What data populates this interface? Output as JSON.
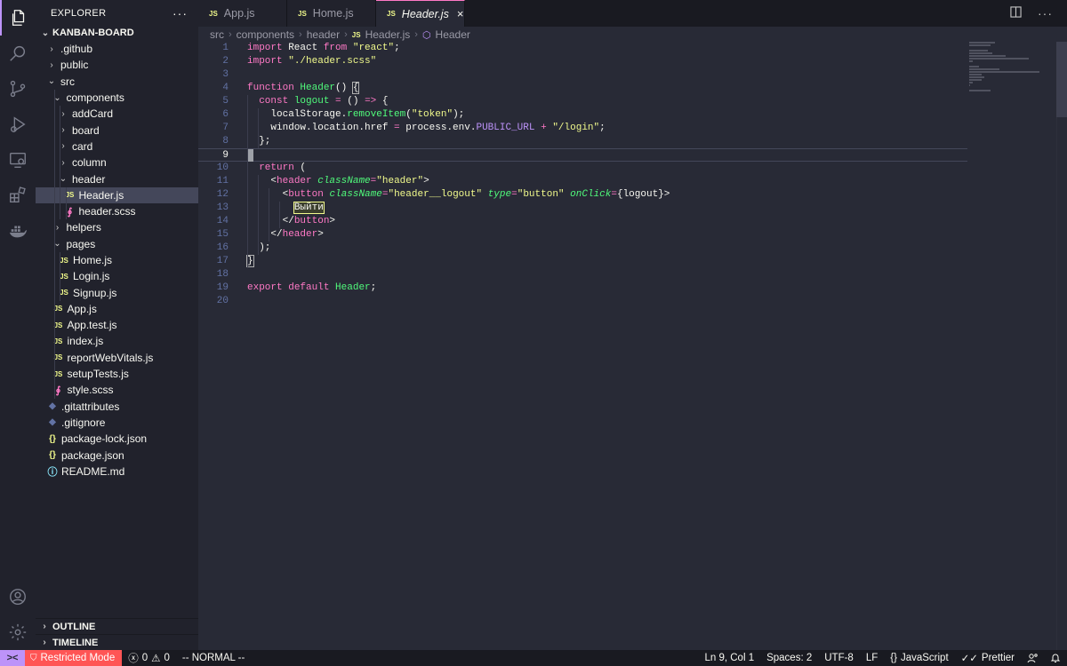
{
  "sidebar": {
    "title": "EXPLORER",
    "more_icon": "···",
    "project": "KANBAN-BOARD",
    "tree": [
      {
        "label": ".github",
        "depth": 1,
        "type": "folder",
        "open": false
      },
      {
        "label": "public",
        "depth": 1,
        "type": "folder",
        "open": false
      },
      {
        "label": "src",
        "depth": 1,
        "type": "folder",
        "open": true
      },
      {
        "label": "components",
        "depth": 2,
        "type": "folder",
        "open": true
      },
      {
        "label": "addCard",
        "depth": 3,
        "type": "folder",
        "open": false
      },
      {
        "label": "board",
        "depth": 3,
        "type": "folder",
        "open": false
      },
      {
        "label": "card",
        "depth": 3,
        "type": "folder",
        "open": false
      },
      {
        "label": "column",
        "depth": 3,
        "type": "folder",
        "open": false
      },
      {
        "label": "header",
        "depth": 3,
        "type": "folder",
        "open": true
      },
      {
        "label": "Header.js",
        "depth": 4,
        "type": "js",
        "selected": true
      },
      {
        "label": "header.scss",
        "depth": 4,
        "type": "scss"
      },
      {
        "label": "helpers",
        "depth": 2,
        "type": "folder",
        "open": false
      },
      {
        "label": "pages",
        "depth": 2,
        "type": "folder",
        "open": true
      },
      {
        "label": "Home.js",
        "depth": 3,
        "type": "js"
      },
      {
        "label": "Login.js",
        "depth": 3,
        "type": "js"
      },
      {
        "label": "Signup.js",
        "depth": 3,
        "type": "js"
      },
      {
        "label": "App.js",
        "depth": 2,
        "type": "js"
      },
      {
        "label": "App.test.js",
        "depth": 2,
        "type": "js"
      },
      {
        "label": "index.js",
        "depth": 2,
        "type": "js"
      },
      {
        "label": "reportWebVitals.js",
        "depth": 2,
        "type": "js"
      },
      {
        "label": "setupTests.js",
        "depth": 2,
        "type": "js"
      },
      {
        "label": "style.scss",
        "depth": 2,
        "type": "scss"
      },
      {
        "label": ".gitattributes",
        "depth": 1,
        "type": "git"
      },
      {
        "label": ".gitignore",
        "depth": 1,
        "type": "git"
      },
      {
        "label": "package-lock.json",
        "depth": 1,
        "type": "json"
      },
      {
        "label": "package.json",
        "depth": 1,
        "type": "json"
      },
      {
        "label": "README.md",
        "depth": 1,
        "type": "info"
      }
    ],
    "outline": "OUTLINE",
    "timeline": "TIMELINE"
  },
  "tabs": [
    {
      "icon": "JS",
      "label": "App.js",
      "active": false
    },
    {
      "icon": "JS",
      "label": "Home.js",
      "active": false
    },
    {
      "icon": "JS",
      "label": "Header.js",
      "active": true
    }
  ],
  "tab_close": "×",
  "breadcrumb": {
    "parts": [
      "src",
      "components",
      "header"
    ],
    "file_icon": "JS",
    "file": "Header.js",
    "symbol": "Header"
  },
  "editor": {
    "current_line": 9,
    "lines": [
      [
        [
          "kw",
          "import"
        ],
        [
          "t",
          " React "
        ],
        [
          "kw",
          "from"
        ],
        [
          "t",
          " "
        ],
        [
          "str",
          "\"react\""
        ],
        [
          "t",
          ";"
        ]
      ],
      [
        [
          "kw",
          "import"
        ],
        [
          "t",
          " "
        ],
        [
          "str",
          "\"./header.scss\""
        ]
      ],
      [],
      [
        [
          "kw",
          "function"
        ],
        [
          "t",
          " "
        ],
        [
          "fn",
          "Header"
        ],
        [
          "t",
          "() "
        ],
        [
          "hl",
          "{"
        ]
      ],
      [
        [
          "t",
          "  "
        ],
        [
          "kw",
          "const"
        ],
        [
          "t",
          " "
        ],
        [
          "fn",
          "logout"
        ],
        [
          "t",
          " "
        ],
        [
          "kw",
          "="
        ],
        [
          "t",
          " () "
        ],
        [
          "kw",
          "=>"
        ],
        [
          "t",
          " {"
        ]
      ],
      [
        [
          "t",
          "    localStorage."
        ],
        [
          "fn",
          "removeItem"
        ],
        [
          "t",
          "("
        ],
        [
          "str",
          "\"token\""
        ],
        [
          "t",
          ");"
        ]
      ],
      [
        [
          "t",
          "    window.location.href "
        ],
        [
          "kw",
          "="
        ],
        [
          "t",
          " process.env."
        ],
        [
          "prop",
          "PUBLIC_URL"
        ],
        [
          "t",
          " "
        ],
        [
          "kw",
          "+"
        ],
        [
          "t",
          " "
        ],
        [
          "str",
          "\"/login\""
        ],
        [
          "t",
          ";"
        ]
      ],
      [
        [
          "t",
          "  };"
        ]
      ],
      [
        [
          "cursor",
          ""
        ]
      ],
      [
        [
          "t",
          "  "
        ],
        [
          "kw",
          "return"
        ],
        [
          "t",
          " ("
        ]
      ],
      [
        [
          "t",
          "    <"
        ],
        [
          "tag",
          "header"
        ],
        [
          "t",
          " "
        ],
        [
          "attr",
          "className"
        ],
        [
          "kw",
          "="
        ],
        [
          "str",
          "\"header\""
        ],
        [
          "t",
          ">"
        ]
      ],
      [
        [
          "t",
          "      <"
        ],
        [
          "tag",
          "button"
        ],
        [
          "t",
          " "
        ],
        [
          "attr",
          "className"
        ],
        [
          "kw",
          "="
        ],
        [
          "str",
          "\"header__logout\""
        ],
        [
          "t",
          " "
        ],
        [
          "attr",
          "type"
        ],
        [
          "kw",
          "="
        ],
        [
          "str",
          "\"button\""
        ],
        [
          "t",
          " "
        ],
        [
          "attr",
          "onClick"
        ],
        [
          "kw",
          "="
        ],
        [
          "t",
          "{logout}>"
        ]
      ],
      [
        [
          "t",
          "        "
        ],
        [
          "text",
          "Выйти"
        ]
      ],
      [
        [
          "t",
          "      </"
        ],
        [
          "tag",
          "button"
        ],
        [
          "t",
          ">"
        ]
      ],
      [
        [
          "t",
          "    </"
        ],
        [
          "tag",
          "header"
        ],
        [
          "t",
          ">"
        ]
      ],
      [
        [
          "t",
          "  );"
        ]
      ],
      [
        [
          "hl",
          "}"
        ]
      ],
      [],
      [
        [
          "kw",
          "export"
        ],
        [
          "t",
          " "
        ],
        [
          "kw",
          "default"
        ],
        [
          "t",
          " "
        ],
        [
          "fn",
          "Header"
        ],
        [
          "t",
          ";"
        ]
      ],
      []
    ]
  },
  "status": {
    "remote_icon": "><",
    "restricted": "Restricted Mode",
    "errors": "0",
    "warnings": "0",
    "mode": "-- NORMAL --",
    "position": "Ln 9, Col 1",
    "spaces": "Spaces: 2",
    "encoding": "UTF-8",
    "eol": "LF",
    "language": "JavaScript",
    "formatter": "Prettier"
  },
  "colors": {
    "accent": "#bd93f9",
    "restricted": "#ff5555",
    "tab_active_border": "#ff79c6"
  }
}
